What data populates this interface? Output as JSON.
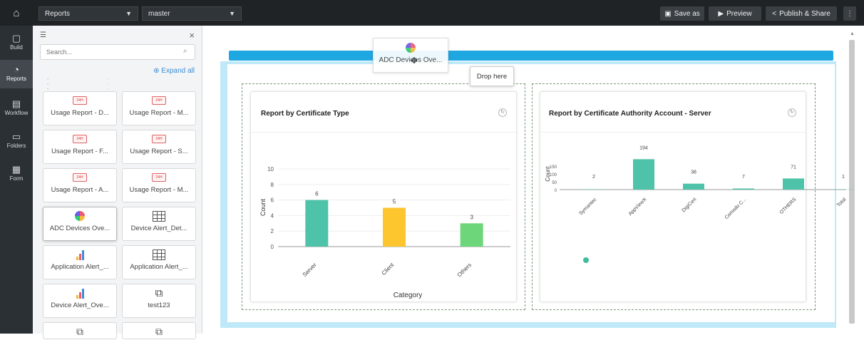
{
  "topbar": {
    "report_select": "Reports",
    "branch_select": "master",
    "save_as": "Save as",
    "preview": "Preview",
    "publish": "Publish & Share"
  },
  "rail": [
    {
      "label": "Build",
      "icon": "build-icon"
    },
    {
      "label": "Reports",
      "icon": "reports-icon"
    },
    {
      "label": "Workflow",
      "icon": "workflow-icon"
    },
    {
      "label": "Folders",
      "icon": "folder-icon"
    },
    {
      "label": "Form",
      "icon": "form-icon"
    }
  ],
  "panel": {
    "search_placeholder": "Search...",
    "expand_all": "⊕ Expand all",
    "items": [
      {
        "label": "Usage Report - D...",
        "icon": "report-tag-icon"
      },
      {
        "label": "Usage Report - M...",
        "icon": "report-tag-icon"
      },
      {
        "label": "Usage Report - F...",
        "icon": "report-tag-icon"
      },
      {
        "label": "Usage Report - S...",
        "icon": "report-tag-icon"
      },
      {
        "label": "Usage Report - A...",
        "icon": "report-tag-icon"
      },
      {
        "label": "Usage Report - M...",
        "icon": "report-tag-icon"
      },
      {
        "label": "ADC Devices Ove...",
        "icon": "pie-chart-icon"
      },
      {
        "label": "Device Alert_Det...",
        "icon": "table-icon"
      },
      {
        "label": "Application Alert_...",
        "icon": "bar-chart-icon"
      },
      {
        "label": "Application Alert_...",
        "icon": "table-icon"
      },
      {
        "label": "Device Alert_Ove...",
        "icon": "bar-chart-icon"
      },
      {
        "label": "test123",
        "icon": "puzzle-icon"
      }
    ]
  },
  "canvas": {
    "drag_label": "ADC Devices Ove...",
    "drop_hint": "Drop here"
  },
  "chart_data": [
    {
      "type": "bar",
      "title": "Report by Certificate Type",
      "xlabel": "Category",
      "ylabel": "Count",
      "categories": [
        "Server",
        "Client",
        "Others"
      ],
      "values": [
        6,
        5,
        3
      ],
      "colors": [
        "#4fc3a9",
        "#fdc62f",
        "#6ed67a"
      ],
      "ylim": [
        0,
        10
      ],
      "yticks": [
        "0",
        "2",
        "4",
        "6",
        "8",
        "10"
      ]
    },
    {
      "type": "bar",
      "title": "Report by Certificate Authority Account - Server",
      "xlabel": "",
      "ylabel": "Count",
      "categories": [
        "Symantec",
        "AppViewX",
        "DigiCert",
        "Comodo C...",
        "OTHERS",
        "Total"
      ],
      "values": [
        2,
        194,
        38,
        7,
        71,
        1
      ],
      "colors": [
        "#4fc3a9",
        "#4fc3a9",
        "#4fc3a9",
        "#4fc3a9",
        "#4fc3a9",
        "#4fc3a9"
      ],
      "ylim": [
        0,
        200
      ],
      "yticks": [
        "0",
        "50",
        "100",
        "150"
      ]
    }
  ]
}
